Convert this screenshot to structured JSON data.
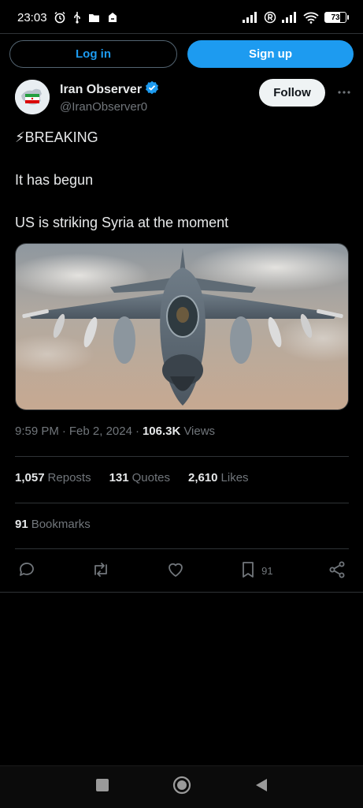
{
  "status_bar": {
    "time": "23:03",
    "battery": "73"
  },
  "auth": {
    "login_label": "Log in",
    "signup_label": "Sign up"
  },
  "author": {
    "name": "Iran Observer",
    "handle": "@IranObserver0",
    "follow_label": "Follow",
    "verified": true
  },
  "tweet": {
    "line1": "⚡BREAKING",
    "line2": "It has begun",
    "line3": "US is striking Syria at the moment"
  },
  "meta": {
    "time": "9:59 PM",
    "date": "Feb 2, 2024",
    "views_count": "106.3K",
    "views_label": "Views"
  },
  "stats": {
    "reposts_count": "1,057",
    "reposts_label": "Reposts",
    "quotes_count": "131",
    "quotes_label": "Quotes",
    "likes_count": "2,610",
    "likes_label": "Likes",
    "bookmarks_count": "91",
    "bookmarks_label": "Bookmarks"
  },
  "actions": {
    "bookmark_count": "91"
  },
  "icons": {
    "reply": "reply-icon",
    "repost": "repost-icon",
    "like": "like-icon",
    "bookmark": "bookmark-icon",
    "share": "share-icon",
    "more": "more-icon",
    "verified": "verified-badge-icon"
  },
  "colors": {
    "accent": "#1d9bf0",
    "background": "#000000",
    "text": "#e7e9ea",
    "muted": "#71767b"
  }
}
